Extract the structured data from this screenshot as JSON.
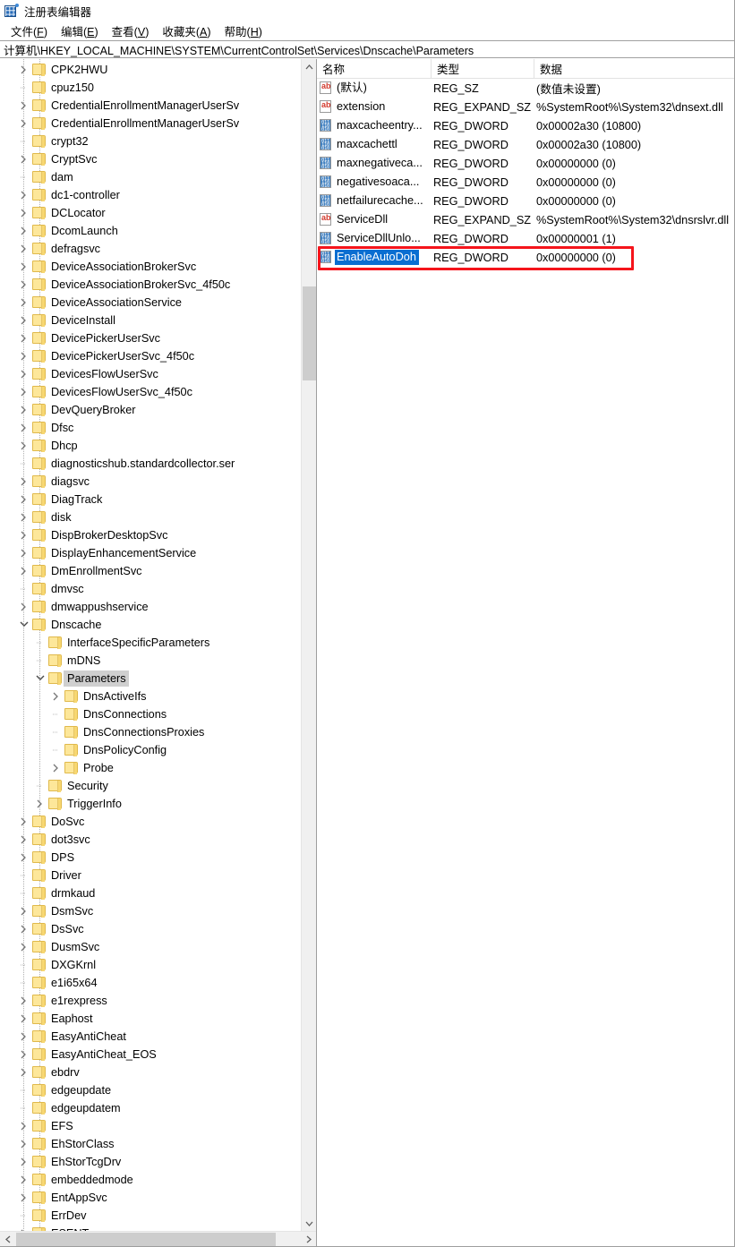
{
  "window": {
    "title": "注册表编辑器",
    "icon": "registry-editor-icon"
  },
  "menubar": {
    "items": [
      {
        "label": "文件(F)",
        "key": "F"
      },
      {
        "label": "编辑(E)",
        "key": "E"
      },
      {
        "label": "查看(V)",
        "key": "V"
      },
      {
        "label": "收藏夹(A)",
        "key": "A"
      },
      {
        "label": "帮助(H)",
        "key": "H"
      }
    ]
  },
  "address": {
    "path": "计算机\\HKEY_LOCAL_MACHINE\\SYSTEM\\CurrentControlSet\\Services\\Dnscache\\Parameters"
  },
  "tree": {
    "items": [
      {
        "label": "CPK2HWU",
        "depth": 2,
        "state": "collapsed"
      },
      {
        "label": "cpuz150",
        "depth": 2,
        "state": "leaf"
      },
      {
        "label": "CredentialEnrollmentManagerUserSv",
        "depth": 2,
        "state": "collapsed"
      },
      {
        "label": "CredentialEnrollmentManagerUserSv",
        "depth": 2,
        "state": "collapsed"
      },
      {
        "label": "crypt32",
        "depth": 2,
        "state": "leaf"
      },
      {
        "label": "CryptSvc",
        "depth": 2,
        "state": "collapsed"
      },
      {
        "label": "dam",
        "depth": 2,
        "state": "leaf"
      },
      {
        "label": "dc1-controller",
        "depth": 2,
        "state": "collapsed"
      },
      {
        "label": "DCLocator",
        "depth": 2,
        "state": "collapsed"
      },
      {
        "label": "DcomLaunch",
        "depth": 2,
        "state": "collapsed"
      },
      {
        "label": "defragsvc",
        "depth": 2,
        "state": "collapsed"
      },
      {
        "label": "DeviceAssociationBrokerSvc",
        "depth": 2,
        "state": "collapsed"
      },
      {
        "label": "DeviceAssociationBrokerSvc_4f50c",
        "depth": 2,
        "state": "collapsed"
      },
      {
        "label": "DeviceAssociationService",
        "depth": 2,
        "state": "collapsed"
      },
      {
        "label": "DeviceInstall",
        "depth": 2,
        "state": "collapsed"
      },
      {
        "label": "DevicePickerUserSvc",
        "depth": 2,
        "state": "collapsed"
      },
      {
        "label": "DevicePickerUserSvc_4f50c",
        "depth": 2,
        "state": "collapsed"
      },
      {
        "label": "DevicesFlowUserSvc",
        "depth": 2,
        "state": "collapsed"
      },
      {
        "label": "DevicesFlowUserSvc_4f50c",
        "depth": 2,
        "state": "collapsed"
      },
      {
        "label": "DevQueryBroker",
        "depth": 2,
        "state": "collapsed"
      },
      {
        "label": "Dfsc",
        "depth": 2,
        "state": "collapsed"
      },
      {
        "label": "Dhcp",
        "depth": 2,
        "state": "collapsed"
      },
      {
        "label": "diagnosticshub.standardcollector.ser",
        "depth": 2,
        "state": "leaf"
      },
      {
        "label": "diagsvc",
        "depth": 2,
        "state": "collapsed"
      },
      {
        "label": "DiagTrack",
        "depth": 2,
        "state": "collapsed"
      },
      {
        "label": "disk",
        "depth": 2,
        "state": "collapsed"
      },
      {
        "label": "DispBrokerDesktopSvc",
        "depth": 2,
        "state": "collapsed"
      },
      {
        "label": "DisplayEnhancementService",
        "depth": 2,
        "state": "collapsed"
      },
      {
        "label": "DmEnrollmentSvc",
        "depth": 2,
        "state": "collapsed"
      },
      {
        "label": "dmvsc",
        "depth": 2,
        "state": "leaf"
      },
      {
        "label": "dmwappushservice",
        "depth": 2,
        "state": "collapsed"
      },
      {
        "label": "Dnscache",
        "depth": 2,
        "state": "expanded"
      },
      {
        "label": "InterfaceSpecificParameters",
        "depth": 3,
        "state": "leaf"
      },
      {
        "label": "mDNS",
        "depth": 3,
        "state": "leaf"
      },
      {
        "label": "Parameters",
        "depth": 3,
        "state": "expanded",
        "selected": true
      },
      {
        "label": "DnsActiveIfs",
        "depth": 4,
        "state": "collapsed"
      },
      {
        "label": "DnsConnections",
        "depth": 4,
        "state": "leaf"
      },
      {
        "label": "DnsConnectionsProxies",
        "depth": 4,
        "state": "leaf"
      },
      {
        "label": "DnsPolicyConfig",
        "depth": 4,
        "state": "leaf"
      },
      {
        "label": "Probe",
        "depth": 4,
        "state": "collapsed"
      },
      {
        "label": "Security",
        "depth": 3,
        "state": "leaf"
      },
      {
        "label": "TriggerInfo",
        "depth": 3,
        "state": "collapsed"
      },
      {
        "label": "DoSvc",
        "depth": 2,
        "state": "collapsed"
      },
      {
        "label": "dot3svc",
        "depth": 2,
        "state": "collapsed"
      },
      {
        "label": "DPS",
        "depth": 2,
        "state": "collapsed"
      },
      {
        "label": "Driver",
        "depth": 2,
        "state": "leaf"
      },
      {
        "label": "drmkaud",
        "depth": 2,
        "state": "leaf"
      },
      {
        "label": "DsmSvc",
        "depth": 2,
        "state": "collapsed"
      },
      {
        "label": "DsSvc",
        "depth": 2,
        "state": "collapsed"
      },
      {
        "label": "DusmSvc",
        "depth": 2,
        "state": "collapsed"
      },
      {
        "label": "DXGKrnl",
        "depth": 2,
        "state": "leaf"
      },
      {
        "label": "e1i65x64",
        "depth": 2,
        "state": "leaf"
      },
      {
        "label": "e1rexpress",
        "depth": 2,
        "state": "collapsed"
      },
      {
        "label": "Eaphost",
        "depth": 2,
        "state": "collapsed"
      },
      {
        "label": "EasyAntiCheat",
        "depth": 2,
        "state": "collapsed"
      },
      {
        "label": "EasyAntiCheat_EOS",
        "depth": 2,
        "state": "collapsed"
      },
      {
        "label": "ebdrv",
        "depth": 2,
        "state": "collapsed"
      },
      {
        "label": "edgeupdate",
        "depth": 2,
        "state": "leaf"
      },
      {
        "label": "edgeupdatem",
        "depth": 2,
        "state": "leaf"
      },
      {
        "label": "EFS",
        "depth": 2,
        "state": "collapsed"
      },
      {
        "label": "EhStorClass",
        "depth": 2,
        "state": "collapsed"
      },
      {
        "label": "EhStorTcgDrv",
        "depth": 2,
        "state": "collapsed"
      },
      {
        "label": "embeddedmode",
        "depth": 2,
        "state": "collapsed"
      },
      {
        "label": "EntAppSvc",
        "depth": 2,
        "state": "collapsed"
      },
      {
        "label": "ErrDev",
        "depth": 2,
        "state": "leaf"
      },
      {
        "label": "ESENT",
        "depth": 2,
        "state": "collapsed"
      }
    ]
  },
  "values": {
    "columns": [
      "名称",
      "类型",
      "数据"
    ],
    "rows": [
      {
        "icon": "string-value-icon",
        "name": "(默认)",
        "type": "REG_SZ",
        "data": "(数值未设置)"
      },
      {
        "icon": "string-value-icon",
        "name": "extension",
        "type": "REG_EXPAND_SZ",
        "data": "%SystemRoot%\\System32\\dnsext.dll"
      },
      {
        "icon": "dword-value-icon",
        "name": "maxcacheentry...",
        "type": "REG_DWORD",
        "data": "0x00002a30 (10800)"
      },
      {
        "icon": "dword-value-icon",
        "name": "maxcachettl",
        "type": "REG_DWORD",
        "data": "0x00002a30 (10800)"
      },
      {
        "icon": "dword-value-icon",
        "name": "maxnegativeca...",
        "type": "REG_DWORD",
        "data": "0x00000000 (0)"
      },
      {
        "icon": "dword-value-icon",
        "name": "negativesoaca...",
        "type": "REG_DWORD",
        "data": "0x00000000 (0)"
      },
      {
        "icon": "dword-value-icon",
        "name": "netfailurecache...",
        "type": "REG_DWORD",
        "data": "0x00000000 (0)"
      },
      {
        "icon": "string-value-icon",
        "name": "ServiceDll",
        "type": "REG_EXPAND_SZ",
        "data": "%SystemRoot%\\System32\\dnsrslvr.dll"
      },
      {
        "icon": "dword-value-icon",
        "name": "ServiceDllUnlo...",
        "type": "REG_DWORD",
        "data": "0x00000001 (1)"
      },
      {
        "icon": "dword-value-icon",
        "name": "EnableAutoDoh",
        "type": "REG_DWORD",
        "data": "0x00000000 (0)",
        "selected": true,
        "annotated": true
      }
    ]
  },
  "colors": {
    "selection": "#0a6ed1",
    "annotation": "#f5141b",
    "folder": "#fde79a",
    "tree_selection": "#cfcfcf"
  },
  "scrollbars": {
    "tree_vertical_arrow_up": "▲",
    "tree_vertical_arrow_down": "▼",
    "tree_horizontal_arrow_left": "◄",
    "tree_horizontal_arrow_right": "►"
  }
}
